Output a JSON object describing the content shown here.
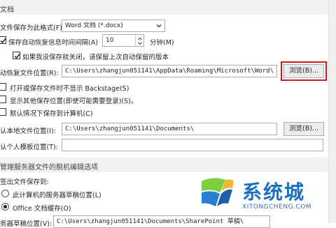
{
  "sections": {
    "save_docs": "文档",
    "offline_editing": "管理服务器文件的脱机编辑选项"
  },
  "save_format": {
    "label": "文件保存为此格式(F):",
    "value": "Word 文档 (*.docx)"
  },
  "autorecover_interval": {
    "label": "保存自动恢复信息时间间隔(A)",
    "value": "10",
    "unit": "分钟(M)"
  },
  "keep_last_autosaved": {
    "label": "如果我没保存就关闭，请保留上次自动保留的版本",
    "checked": true
  },
  "autorecover_location": {
    "label": "动恢复文件位置(R):",
    "value": "C:\\Users\\zhangjun051141\\AppData\\Roaming\\Microsoft\\Word\\",
    "browse_label": "浏览(B)..."
  },
  "no_backstage": {
    "label": "打开或保存文件时不显示 Backstage(S)",
    "checked": false
  },
  "show_extra_places": {
    "label": "显示其他保存位置(即使可能需要登录)(S)。",
    "checked": false
  },
  "default_to_computer": {
    "label": "默认情况下保存到计算机(C)",
    "checked": false
  },
  "default_local_location": {
    "label": "认本地文件位置(I):",
    "value": "C:\\Users\\zhangjun051141\\Documents\\",
    "browse_label": "浏览(B)..."
  },
  "personal_templates": {
    "label": "认个人模板位置(T):",
    "value": ""
  },
  "checkout_label": "签出文件保存到:",
  "radio_server_drafts": "此计算机的服务器草稿位置(L)",
  "radio_office_cache": "Office 文档缓存(O)",
  "server_drafts_location": {
    "label": "务器草稿位置(V):",
    "value": "C:\\Users\\zhangjun051141\\Documents\\SharePoint 草稿\\"
  },
  "watermark": {
    "brand": "系统城",
    "url": "XITONGCHENG.COM"
  },
  "colors": {
    "highlight": "#d11a1a",
    "watermark_blue": "#1d6fc0"
  }
}
